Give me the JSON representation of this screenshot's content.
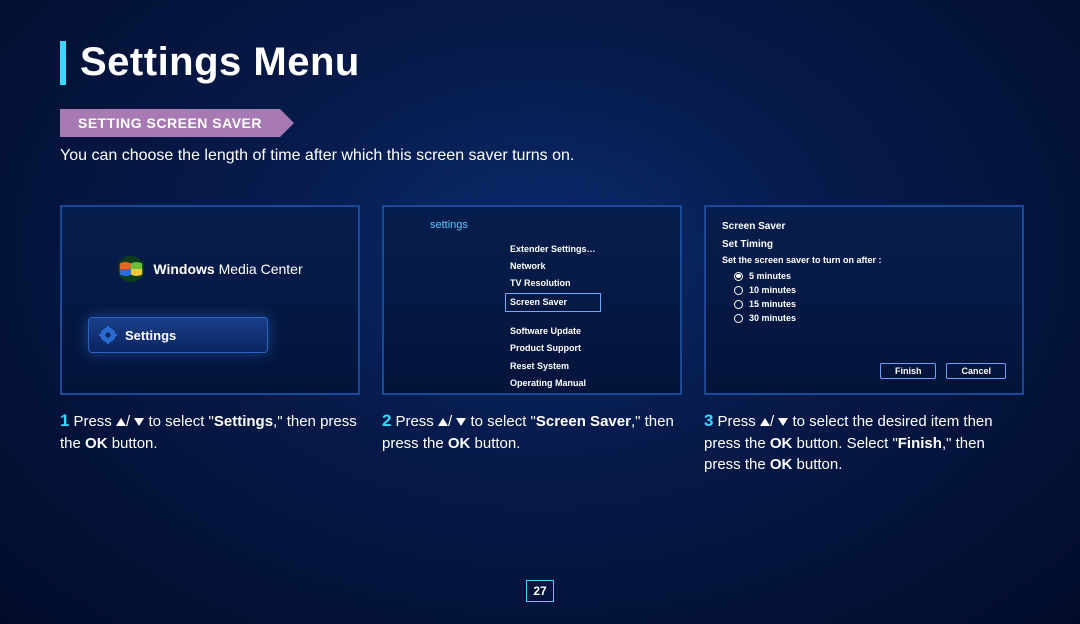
{
  "title": "Settings Menu",
  "section_heading": "SETTING SCREEN SAVER",
  "intro": "You can choose the length of time after which this screen saver turns on.",
  "panel1": {
    "brand_prefix": "Windows",
    "brand_suffix": "Media Center",
    "settings_label": "Settings"
  },
  "panel2": {
    "header": "settings",
    "items_top": [
      "Extender Settings…",
      "Network",
      "TV Resolution"
    ],
    "selected": "Screen Saver",
    "items_bottom": [
      "Software Update",
      "Product Support",
      "Reset System",
      "Operating Manual"
    ]
  },
  "panel3": {
    "title": "Screen Saver",
    "subtitle": "Set Timing",
    "instruction": "Set the screen saver to turn on after :",
    "options": [
      {
        "label": "5 minutes",
        "selected": true
      },
      {
        "label": "10 minutes",
        "selected": false
      },
      {
        "label": "15 minutes",
        "selected": false
      },
      {
        "label": "30 minutes",
        "selected": false
      }
    ],
    "finish": "Finish",
    "cancel": "Cancel"
  },
  "captions": {
    "c1_a": "Press ",
    "c1_b": " to select \"",
    "c1_bold": "Settings",
    "c1_c": ",\" then press the ",
    "c1_ok": "OK",
    "c1_d": " button.",
    "c2_a": "Press ",
    "c2_b": " to select \"",
    "c2_bold": "Screen Saver",
    "c2_c": ",\" then press the ",
    "c2_ok": "OK",
    "c2_d": " button.",
    "c3_a": "Press ",
    "c3_b": " to select the desired item then press the ",
    "c3_ok1": "OK",
    "c3_c": " button. Select \"",
    "c3_bold": "Finish",
    "c3_d": ",\" then press the ",
    "c3_ok2": "OK",
    "c3_e": " button."
  },
  "nums": {
    "n1": "1",
    "n2": "2",
    "n3": "3"
  },
  "slash": "/ ",
  "page_number": "27"
}
